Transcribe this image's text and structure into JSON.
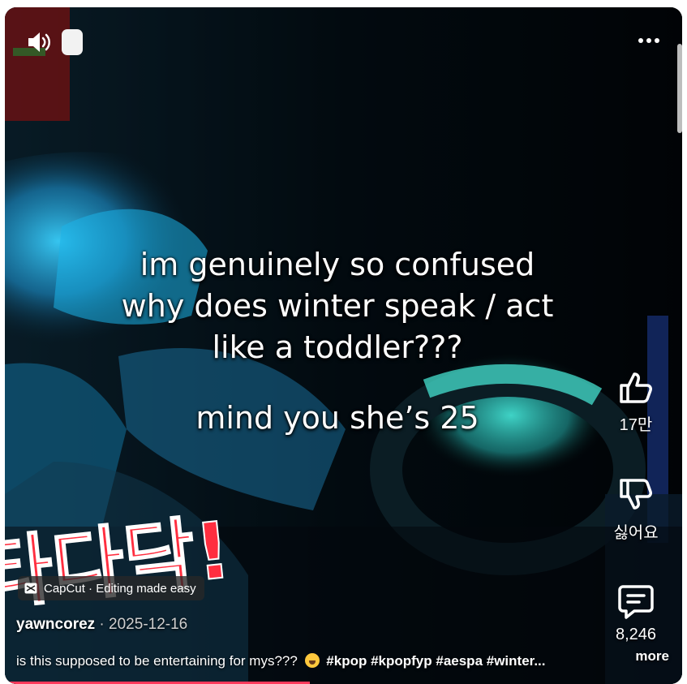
{
  "player": {
    "caption_lines": [
      "im genuinely so confused",
      "why does winter speak / act",
      "like a toddler???",
      "mind you she’s 25"
    ],
    "overlay_korean": "타다닥!",
    "progress_fraction": 0.45,
    "accent_color": "#ff3b5c"
  },
  "controls": {
    "sound_icon": "speaker-icon",
    "pip_icon": "rounded-square-icon",
    "more_icon": "more-dots-icon"
  },
  "rail": {
    "like_count": "17만",
    "dislike_label": "싫어요",
    "comment_count": "8,246"
  },
  "info": {
    "capcut_label": "CapCut · Editing made easy",
    "author": "yawncorez",
    "date_sep": " · ",
    "date": "2025-12-16",
    "description": "is this supposed to be entertaining for mys???",
    "hashtags": "#kpop #kpopfyp #aespa #winter...",
    "more_label": "more"
  }
}
